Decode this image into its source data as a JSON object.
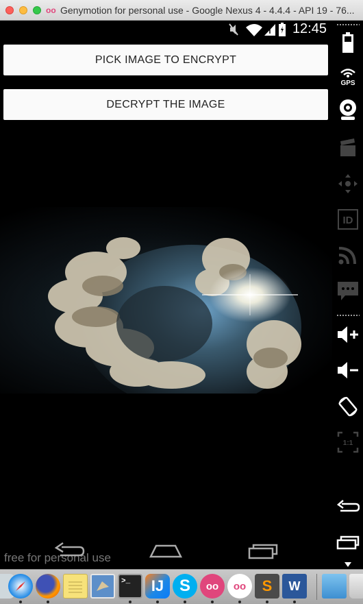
{
  "window": {
    "title": "Genymotion for personal use - Google Nexus 4 - 4.4.4 - API 19 - 76...",
    "app_icon_text": "oo"
  },
  "statusbar": {
    "time": "12:45",
    "icons": [
      "mute-icon",
      "wifi-icon",
      "signal-icon",
      "battery-icon"
    ]
  },
  "buttons": {
    "pick_label": "PICK IMAGE TO ENCRYPT",
    "decrypt_label": "DECRYPT THE IMAGE"
  },
  "image": {
    "description_icon": "earth-clouds-image"
  },
  "navbar": {
    "watermark": "free for personal use",
    "icons": [
      "back-icon",
      "home-icon",
      "recents-icon"
    ]
  },
  "sidebar": {
    "gps_label": "GPS",
    "id_label": "ID",
    "pixel_label": "1:1"
  },
  "dock": {
    "items": [
      {
        "name": "safari",
        "color": "#1e88e5"
      },
      {
        "name": "firefox",
        "color": "#e65100"
      },
      {
        "name": "notes",
        "color": "#f4d03f"
      },
      {
        "name": "preview",
        "color": "#5d8fc9"
      },
      {
        "name": "terminal",
        "color": "#222222"
      },
      {
        "name": "intellij",
        "color": "#1e88e5"
      },
      {
        "name": "skype",
        "color": "#00aff0"
      },
      {
        "name": "genymotion",
        "color": "#e0467c"
      },
      {
        "name": "genymotion-player",
        "color": "#ffffff"
      },
      {
        "name": "sublime",
        "color": "#4a4a4a"
      },
      {
        "name": "word",
        "color": "#2b579a"
      },
      {
        "name": "folder",
        "color": "#4fa3e0"
      },
      {
        "name": "trash",
        "color": "#d8d8d8"
      }
    ],
    "intellij_label": "IJ",
    "skype_label": "S",
    "sublime_label": "S",
    "word_label": "W",
    "terminal_label": ">_"
  }
}
